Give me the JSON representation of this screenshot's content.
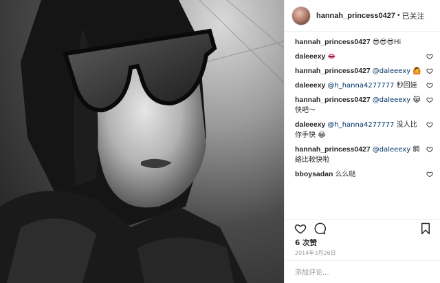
{
  "post": {
    "username": "hannah_princess0427",
    "separator": "•",
    "follow_status": "已关注"
  },
  "comments": [
    {
      "user": "hannah_princess0427",
      "text": "😎😎😎Hi"
    },
    {
      "user": "daleeexy",
      "text": "👄"
    },
    {
      "user": "hannah_princess0427",
      "text": "@daleeexy 🙆"
    },
    {
      "user": "daleeexy",
      "text": "@h_hanna4277777 秒回娃"
    },
    {
      "user": "hannah_princess0427",
      "text": "@daleeexy 😹 快吧～"
    },
    {
      "user": "daleeexy",
      "text": "@h_hanna4277777 没人比你手快 😂"
    },
    {
      "user": "hannah_princess0427",
      "text": "@daleeexy 網絡比較快啦"
    },
    {
      "user": "bboysadan",
      "text": "么么哒"
    }
  ],
  "likes_text": "6 次赞",
  "date_text": "2014年3月26日",
  "add_comment_placeholder": "添加评论...",
  "icons": {
    "like": "heart-icon",
    "comment": "comment-bubble-icon",
    "save": "bookmark-icon",
    "comment_like": "small-heart-icon"
  }
}
